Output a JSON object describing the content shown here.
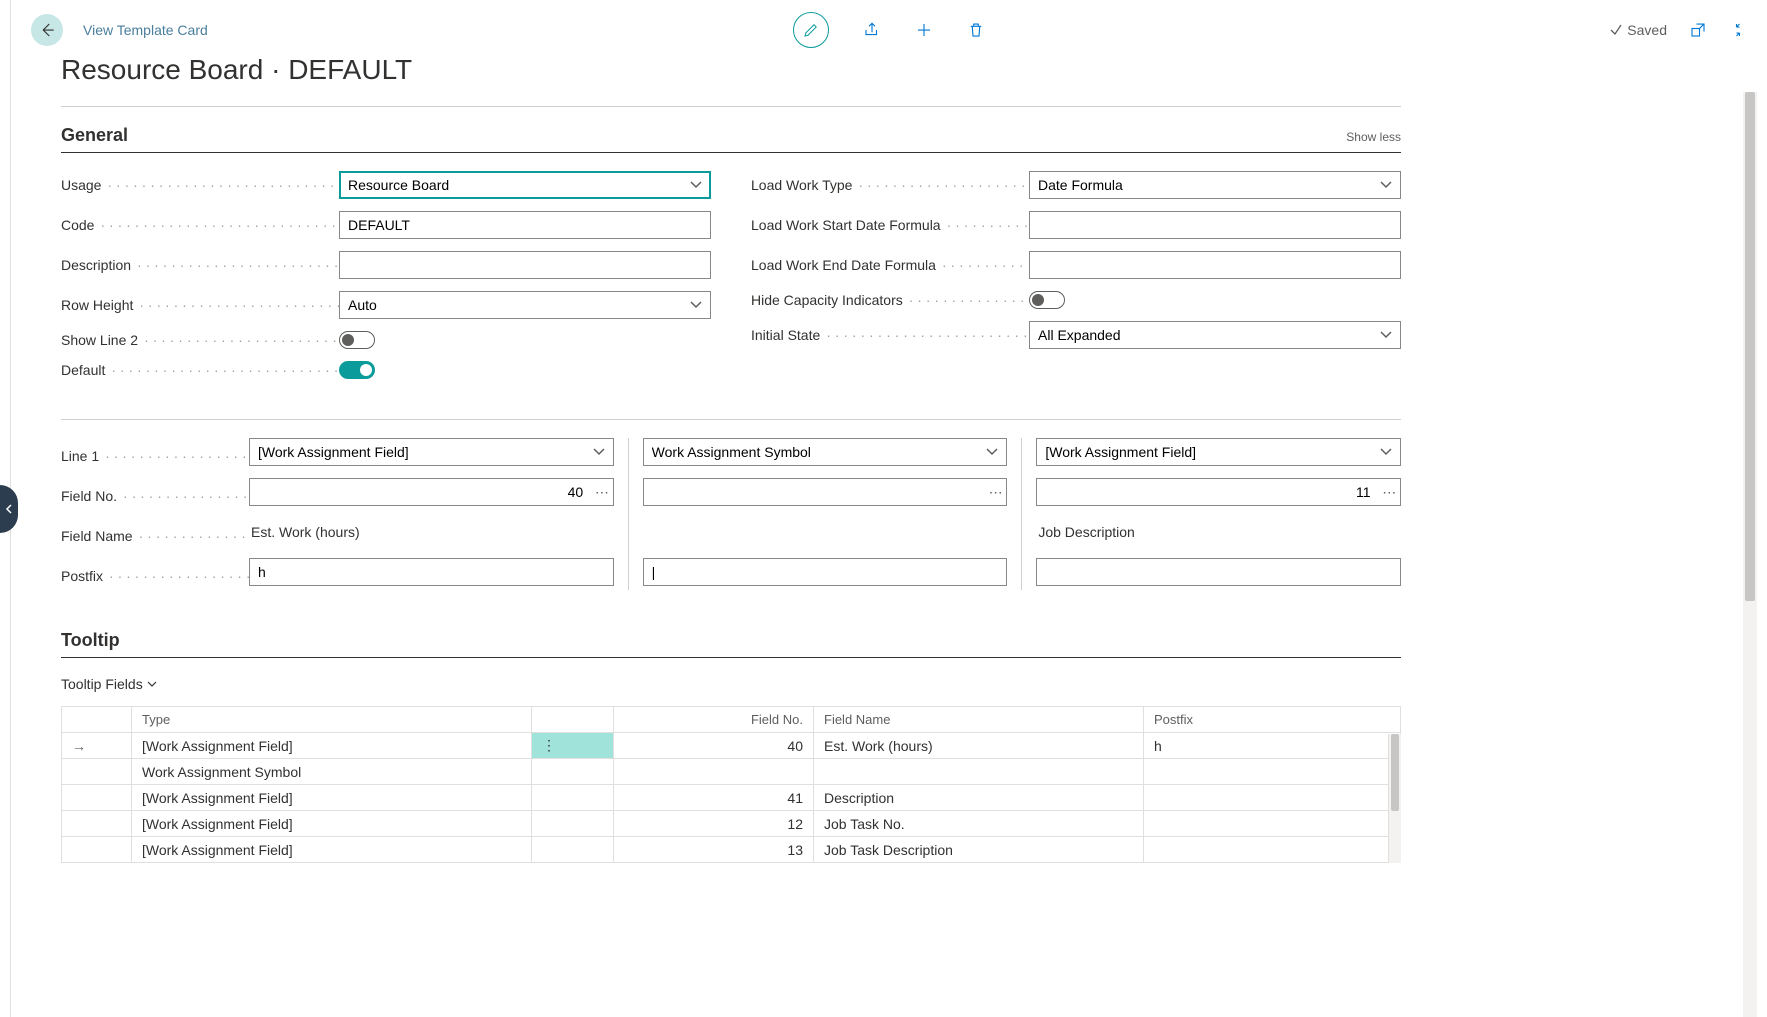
{
  "header": {
    "breadcrumb": "View Template Card",
    "saved_label": "Saved"
  },
  "page_title": "Resource Board · DEFAULT",
  "sections": {
    "general": {
      "title": "General",
      "show_less": "Show less",
      "fields": {
        "usage": {
          "label": "Usage",
          "value": "Resource Board"
        },
        "code": {
          "label": "Code",
          "value": "DEFAULT"
        },
        "description": {
          "label": "Description",
          "value": ""
        },
        "row_height": {
          "label": "Row Height",
          "value": "Auto"
        },
        "show_line2": {
          "label": "Show Line 2",
          "value": false
        },
        "default": {
          "label": "Default",
          "value": true
        },
        "load_work_type": {
          "label": "Load Work Type",
          "value": "Date Formula"
        },
        "load_start": {
          "label": "Load Work Start Date Formula",
          "value": ""
        },
        "load_end": {
          "label": "Load Work End Date Formula",
          "value": ""
        },
        "hide_capacity": {
          "label": "Hide Capacity Indicators",
          "value": false
        },
        "initial_state": {
          "label": "Initial State",
          "value": "All Expanded"
        }
      }
    },
    "line1": {
      "labels": {
        "line1": "Line 1",
        "field_no": "Field No.",
        "field_name": "Field Name",
        "postfix": "Postfix"
      },
      "cols": [
        {
          "type": "[Work Assignment Field]",
          "field_no": "40",
          "field_name": "Est. Work (hours)",
          "postfix": "h"
        },
        {
          "type": "Work Assignment Symbol",
          "field_no": "",
          "field_name": "",
          "postfix": "|"
        },
        {
          "type": "[Work Assignment Field]",
          "field_no": "11",
          "field_name": "Job Description",
          "postfix": ""
        }
      ]
    },
    "tooltip": {
      "title": "Tooltip",
      "subtitle": "Tooltip Fields",
      "columns": {
        "type": "Type",
        "field_no": "Field No.",
        "field_name": "Field Name",
        "postfix": "Postfix"
      },
      "rows": [
        {
          "sel": true,
          "type": "[Work Assignment Field]",
          "field_no": "40",
          "field_name": "Est. Work (hours)",
          "postfix": "h"
        },
        {
          "sel": false,
          "type": "Work Assignment Symbol",
          "field_no": "",
          "field_name": "",
          "postfix": ""
        },
        {
          "sel": false,
          "type": "[Work Assignment Field]",
          "field_no": "41",
          "field_name": "Description",
          "postfix": ""
        },
        {
          "sel": false,
          "type": "[Work Assignment Field]",
          "field_no": "12",
          "field_name": "Job Task No.",
          "postfix": ""
        },
        {
          "sel": false,
          "type": "[Work Assignment Field]",
          "field_no": "13",
          "field_name": "Job Task Description",
          "postfix": ""
        }
      ]
    }
  }
}
